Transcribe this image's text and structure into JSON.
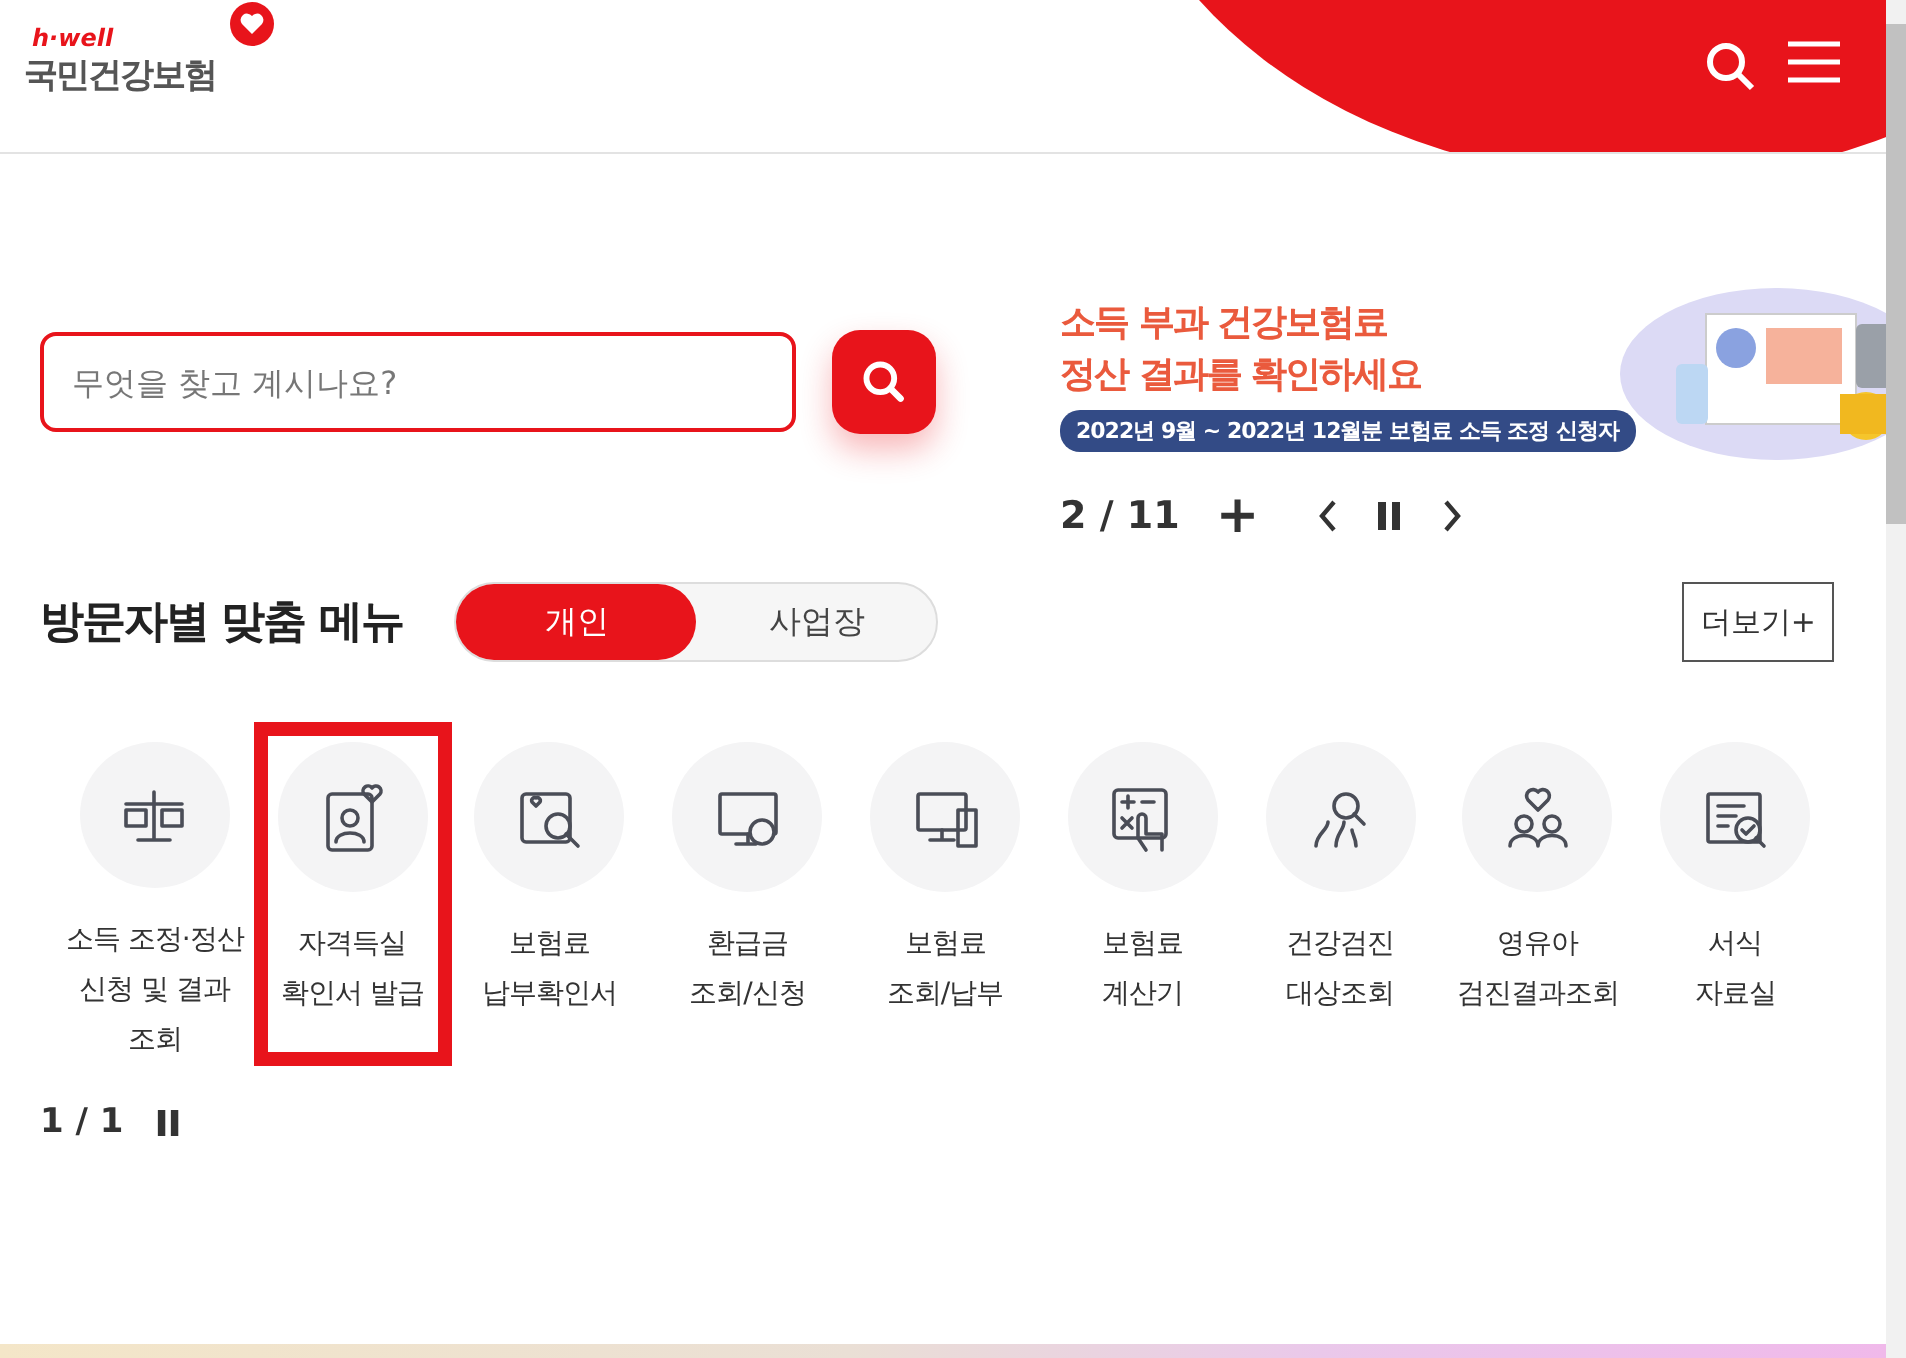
{
  "header": {
    "logo_tagline": "h·well",
    "logo_name": "국민건강보험"
  },
  "search": {
    "placeholder": "무엇을 찾고 계시나요?"
  },
  "banner": {
    "line_1": "소득 부과 건강보험료",
    "line_2": "정산 결과를 확인하세요",
    "pill": "2022년 9월 ~ 2022년 12월분 보험료 소득 조정 신청자",
    "pager": "2 / 11",
    "plus": "+"
  },
  "visitor_menu": {
    "title": "방문자별 맞춤 메뉴",
    "tabs": [
      {
        "label": "개인",
        "selected": true
      },
      {
        "label": "사업장",
        "selected": false
      }
    ],
    "more": "더보기+",
    "items": [
      {
        "label": "소득 조정·정산\n신청 및 결과\n조회",
        "highlighted": false
      },
      {
        "label": "자격득실\n확인서 발급",
        "highlighted": true
      },
      {
        "label": "보험료\n납부확인서",
        "highlighted": false
      },
      {
        "label": "환급금\n조회/신청",
        "highlighted": false
      },
      {
        "label": "보험료\n조회/납부",
        "highlighted": false
      },
      {
        "label": "보험료\n계산기",
        "highlighted": false
      },
      {
        "label": "건강검진\n대상조회",
        "highlighted": false
      },
      {
        "label": "영유아\n검진결과조회",
        "highlighted": false
      },
      {
        "label": "서식\n자료실",
        "highlighted": false
      }
    ],
    "pager": "1 / 1"
  }
}
